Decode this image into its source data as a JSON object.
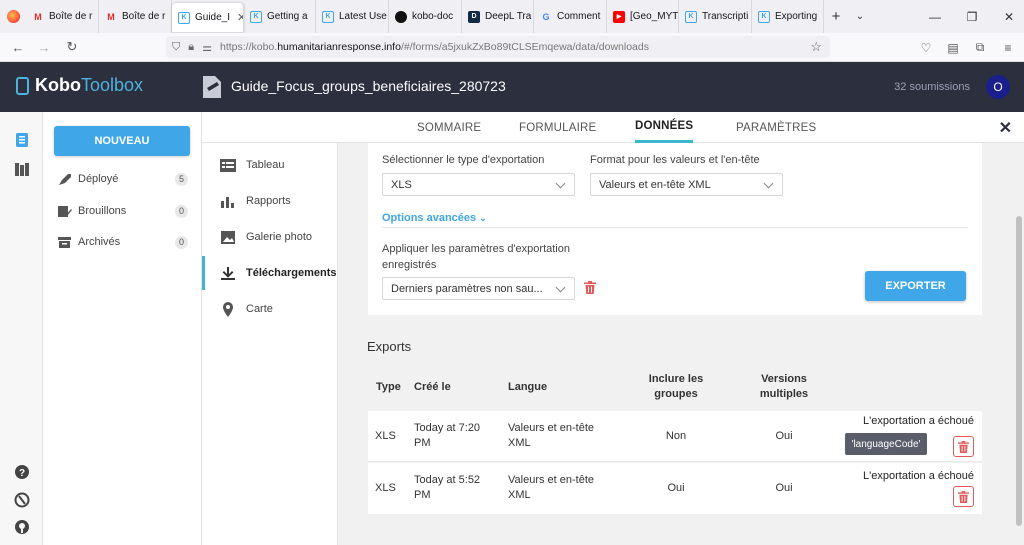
{
  "browser": {
    "tabs": [
      {
        "label": "Boîte de r",
        "icon": "gmail-icon"
      },
      {
        "label": "Boîte de r",
        "icon": "gmail-icon"
      },
      {
        "label": "Guide_I",
        "icon": "kobo-icon",
        "active": true
      },
      {
        "label": "Getting a",
        "icon": "kobo-icon"
      },
      {
        "label": "Latest Use",
        "icon": "kobo-icon"
      },
      {
        "label": "kobo-doc",
        "icon": "github-icon"
      },
      {
        "label": "DeepL Tra",
        "icon": "deepl-icon"
      },
      {
        "label": "Comment",
        "icon": "google-icon"
      },
      {
        "label": "[Geo_MYT",
        "icon": "youtube-icon"
      },
      {
        "label": "Transcripti",
        "icon": "kobo-icon"
      },
      {
        "label": "Exporting",
        "icon": "kobo-icon"
      }
    ],
    "url_prefix": "https://kobo.",
    "url_domain": "humanitarianresponse.info",
    "url_path": "/#/forms/a5jxukZxBo89tCLSEmqewa/data/downloads"
  },
  "header": {
    "logo_bold": "Kobo",
    "logo_light": "Toolbox",
    "form_title": "Guide_Focus_groups_beneficiaires_280723",
    "submissions": "32 soumissions",
    "avatar_letter": "O"
  },
  "sidebar": {
    "new_button": "NOUVEAU",
    "items": [
      {
        "label": "Déployé",
        "count": "5"
      },
      {
        "label": "Brouillons",
        "count": "0"
      },
      {
        "label": "Archivés",
        "count": "0"
      }
    ]
  },
  "top_tabs": [
    "SOMMAIRE",
    "FORMULAIRE",
    "DONNÉES",
    "PARAMÈTRES"
  ],
  "data_nav": [
    "Tableau",
    "Rapports",
    "Galerie photo",
    "Téléchargements",
    "Carte"
  ],
  "export_form": {
    "type_label": "Sélectionner le type d'exportation",
    "type_value": "XLS",
    "format_label": "Format pour les valeurs et l'en-tête",
    "format_value": "Valeurs et en-tête XML",
    "advanced": "Options avancées",
    "apply_label_1": "Appliquer les paramètres d'exportation",
    "apply_label_2": "enregistrés",
    "saved_value": "Derniers paramètres non sau...",
    "export_button": "EXPORTER"
  },
  "exports": {
    "title": "Exports",
    "headers": {
      "type": "Type",
      "created": "Créé le",
      "language": "Langue",
      "groups_1": "Inclure les",
      "groups_2": "groupes",
      "versions_1": "Versions",
      "versions_2": "multiples"
    },
    "rows": [
      {
        "type": "XLS",
        "created_1": "Today at 7:20",
        "created_2": "PM",
        "lang_1": "Valeurs et en-tête",
        "lang_2": "XML",
        "groups": "Non",
        "versions": "Oui",
        "status": "L'exportation a échoué"
      },
      {
        "type": "XLS",
        "created_1": "Today at 5:52",
        "created_2": "PM",
        "lang_1": "Valeurs et en-tête",
        "lang_2": "XML",
        "groups": "Oui",
        "versions": "Oui",
        "status": "L'exportation a échoué"
      }
    ],
    "tooltip": "'languageCode'"
  }
}
